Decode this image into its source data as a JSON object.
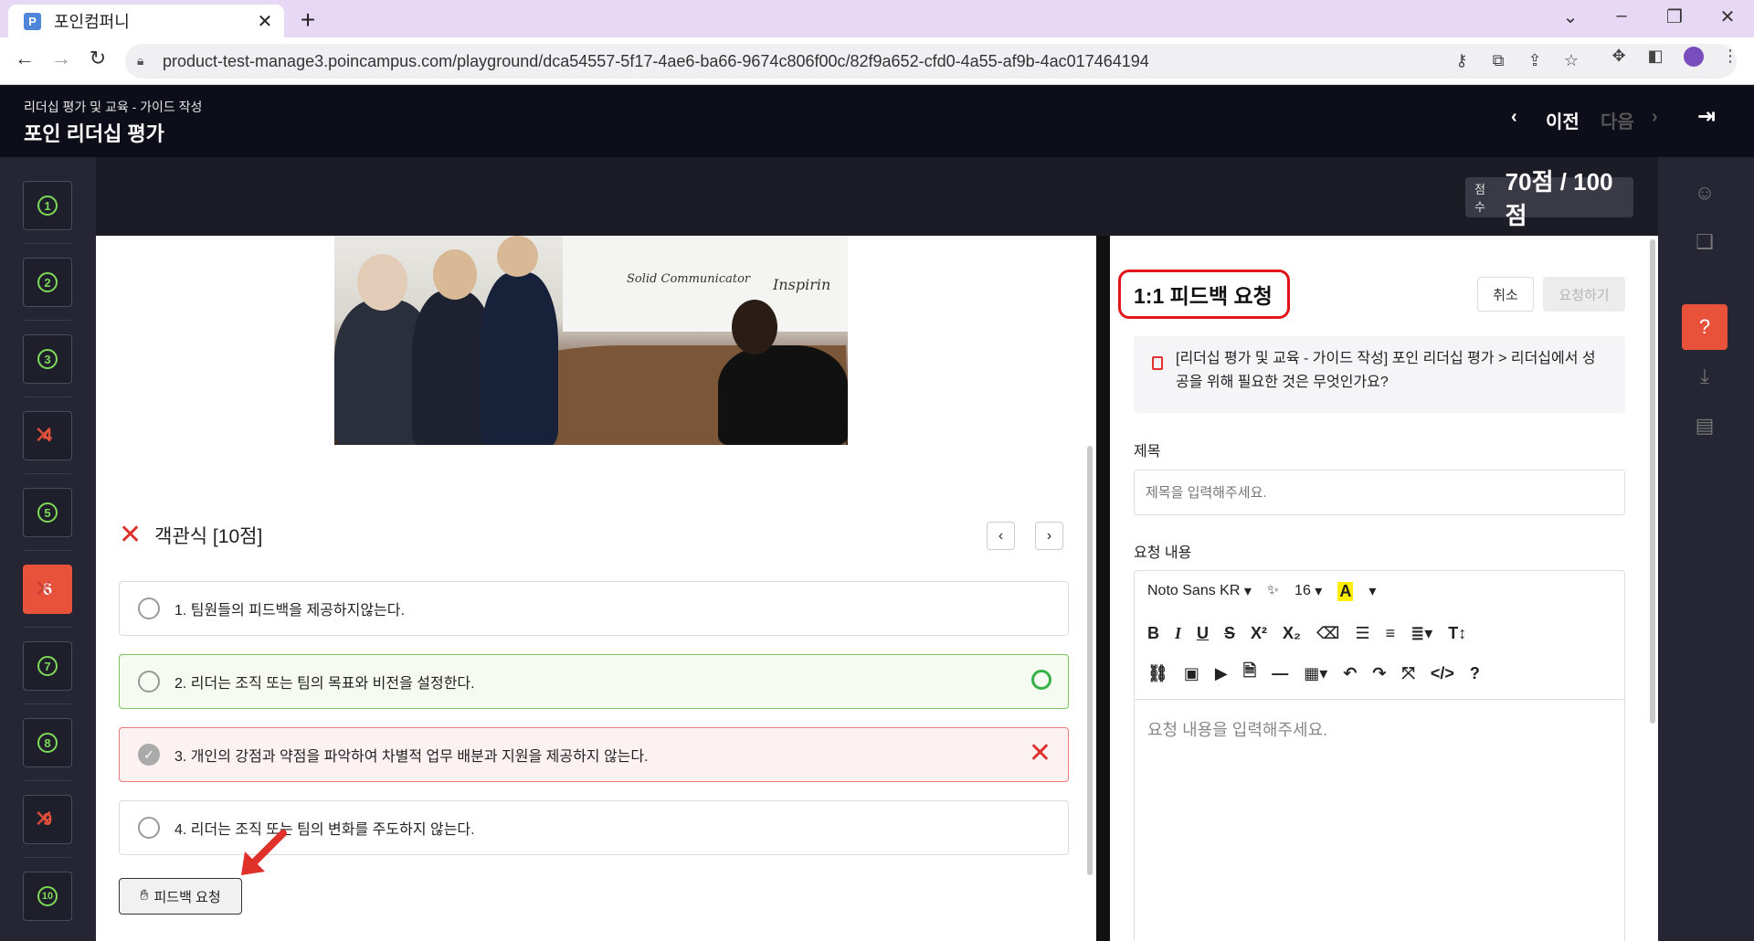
{
  "browser": {
    "tab_title": "포인컴퍼니",
    "favicon": "P",
    "tab_close": "✕",
    "new_tab": "+",
    "url": "product-test-manage3.poincampus.com/playground/dca54557-5f17-4ae6-ba66-9674c806f00c/82f9a652-cfd0-4a55-af9b-4ac017464194"
  },
  "header": {
    "breadcrumb": "리더십 평가 및 교육 - 가이드 작성",
    "course_title": "포인 리더십 평가",
    "prev_label": "이전",
    "next_label": "다음"
  },
  "questions": [
    {
      "num": "1",
      "state": "correct"
    },
    {
      "num": "2",
      "state": "correct"
    },
    {
      "num": "3",
      "state": "correct"
    },
    {
      "num": "4",
      "state": "wrong"
    },
    {
      "num": "5",
      "state": "correct"
    },
    {
      "num": "6",
      "state": "active"
    },
    {
      "num": "7",
      "state": "correct"
    },
    {
      "num": "8",
      "state": "correct"
    },
    {
      "num": "9",
      "state": "wrong"
    },
    {
      "num": "10",
      "state": "correct"
    }
  ],
  "score": {
    "label": "점수",
    "value": "70점 / 100점"
  },
  "image": {
    "board_text_1": "Solid Communicator",
    "board_text_2": "Inspirin"
  },
  "question": {
    "header": "객관식 [10점]",
    "options": [
      {
        "text": "1. 팀원들의 피드백을 제공하지않는다.",
        "state": "none"
      },
      {
        "text": "2. 리더는 조직 또는 팀의 목표와 비전을 설정한다.",
        "state": "correct"
      },
      {
        "text": "3. 개인의 강점과 약점을 파악하여 차별적 업무 배분과 지원을 제공하지 않는다.",
        "state": "selected-wrong"
      },
      {
        "text": "4. 리더는 조직 또는 팀의 변화를 주도하지 않는다.",
        "state": "none"
      }
    ],
    "feedback_button": "피드백 요청"
  },
  "feedback_panel": {
    "title": "1:1 피드백 요청",
    "cancel": "취소",
    "submit": "요청하기",
    "reference": "[리더십 평가 및 교육 - 가이드 작성] 포인 리더십 평가 > 리더십에서 성공을 위해 필요한 것은 무엇인가요?",
    "subject_label": "제목",
    "subject_placeholder": "제목을 입력해주세요.",
    "content_label": "요청 내용",
    "content_placeholder": "요청 내용을 입력해주세요.",
    "toolbar": {
      "font": "Noto Sans KR",
      "size": "16"
    }
  },
  "colors": {
    "accent": "#e8523a",
    "correct": "#38b048",
    "wrong": "#e0302a",
    "highlight_box": "#e0141a"
  }
}
